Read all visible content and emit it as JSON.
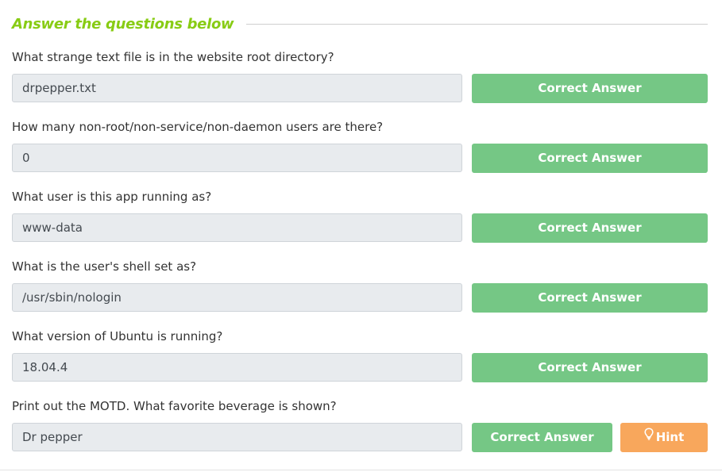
{
  "section": {
    "title": "Answer the questions below"
  },
  "questions": [
    {
      "label": "What strange text file is in the website root directory?",
      "answer": "drpepper.txt",
      "button": "Correct Answer"
    },
    {
      "label": "How many non-root/non-service/non-daemon users are there?",
      "answer": "0",
      "button": "Correct Answer"
    },
    {
      "label": "What user is this app running as?",
      "answer": "www-data",
      "button": "Correct Answer"
    },
    {
      "label": "What is the user's shell set as?",
      "answer": "/usr/sbin/nologin",
      "button": "Correct Answer"
    },
    {
      "label": "What version of Ubuntu is running?",
      "answer": "18.04.4",
      "button": "Correct Answer"
    },
    {
      "label": "Print out the MOTD.  What favorite beverage is shown?",
      "answer": "Dr pepper",
      "button": "Correct Answer",
      "hint": "Hint",
      "hint_icon": "lightbulb-icon"
    }
  ],
  "colors": {
    "accent_title": "#88cc14",
    "correct_button": "#75c785",
    "hint_button": "#f8a75c",
    "input_bg": "#e8ebee"
  }
}
